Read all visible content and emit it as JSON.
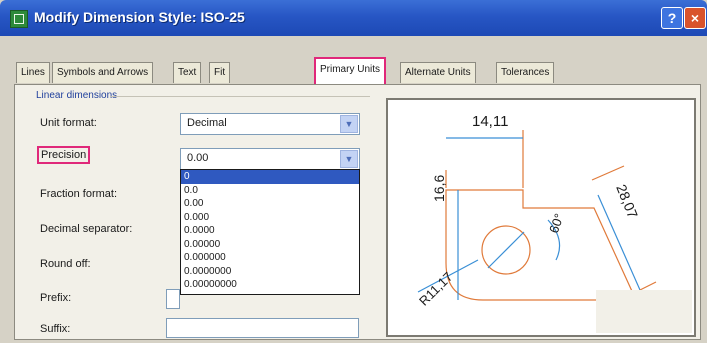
{
  "window": {
    "title": "Modify Dimension Style: ISO-25",
    "help": "?",
    "close": "×"
  },
  "tabs": [
    "Lines",
    "Symbols and Arrows",
    "Text",
    "Fit",
    "Primary Units",
    "Alternate Units",
    "Tolerances"
  ],
  "group": "Linear dimensions",
  "labels": {
    "unit_format": "Unit format:",
    "precision": "Precision",
    "fraction_format": "Fraction format:",
    "decimal_separator": "Decimal separator:",
    "round_off": "Round off:",
    "prefix": "Prefix:",
    "suffix": "Suffix:"
  },
  "unit_format_value": "Decimal",
  "precision_value": "0.00",
  "precision_options": [
    "0",
    "0.0",
    "0.00",
    "0.000",
    "0.0000",
    "0.00000",
    "0.000000",
    "0.0000000",
    "0.00000000"
  ],
  "preview": {
    "top": "14,11",
    "left": "16,6",
    "right": "28,07",
    "angle": "60°",
    "radius": "R11,17"
  },
  "colors": {
    "accent": "#e0287a",
    "selection": "#2f59c0",
    "dim_line": "#3a8fd6",
    "object_line": "#e07a3a"
  }
}
